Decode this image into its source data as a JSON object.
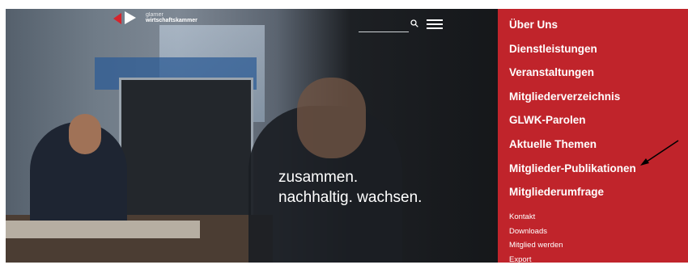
{
  "logo": {
    "line1": "glarner",
    "line2": "wirtschaftskammer"
  },
  "hero": {
    "tagline_line1": "zusammen.",
    "tagline_line2": "nachhaltig. wachsen."
  },
  "header": {
    "search_placeholder": "",
    "search_icon": "search-icon",
    "menu_icon": "hamburger-menu-icon"
  },
  "menu": {
    "main": [
      "Über Uns",
      "Dienstleistungen",
      "Veranstaltungen",
      "Mitgliederverzeichnis",
      "GLWK-Parolen",
      "Aktuelle Themen",
      "Mitglieder-Publikationen",
      "Mitgliederumfrage"
    ],
    "sub": [
      "Kontakt",
      "Downloads",
      "Mitglied werden",
      "Export"
    ]
  },
  "colors": {
    "menu_background": "#c0242b",
    "logo_red": "#d6242c"
  }
}
